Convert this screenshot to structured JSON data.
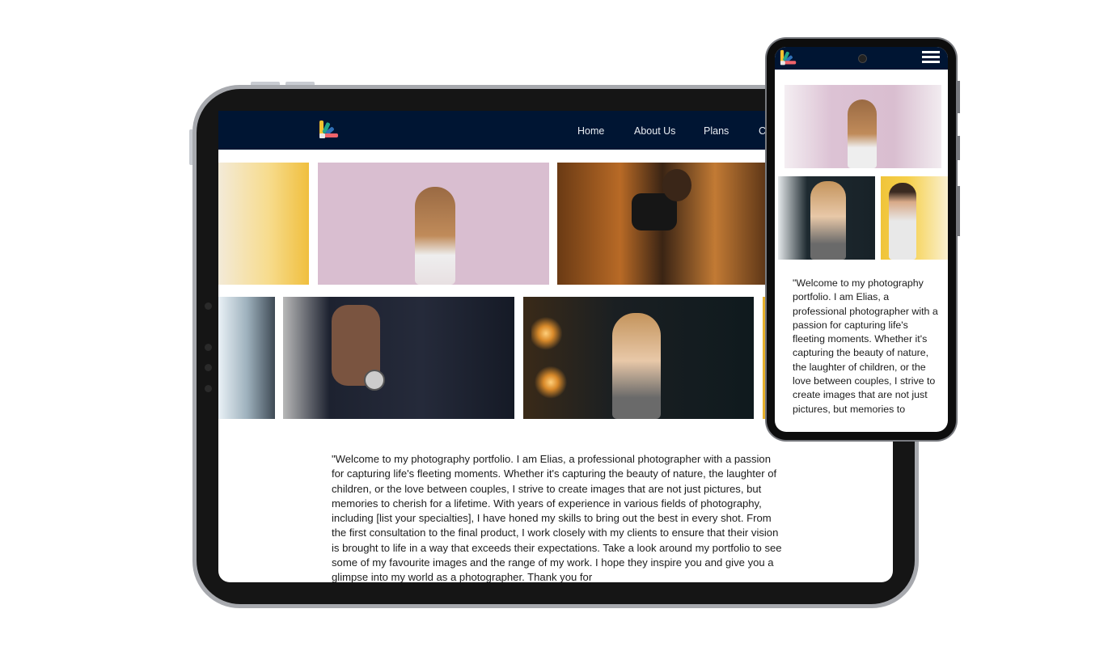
{
  "brand": {
    "logo": "palette-fan-logo",
    "colors": {
      "nav_bg": "#001533",
      "logo": [
        "#f5c12e",
        "#22a58a",
        "#2f6fb6",
        "#f0636a",
        "#e8e8e8"
      ]
    }
  },
  "tablet": {
    "nav": {
      "links": [
        "Home",
        "About Us",
        "Plans",
        "C"
      ]
    },
    "gallery": {
      "row1": [
        "yellow-flowers-photo",
        "woman-pink-background-photo",
        "camera-toss-forest-photo"
      ],
      "row2": [
        "blurred-building-photo",
        "man-suit-watch-photo",
        "woman-lights-photo",
        "yellow-partial-photo"
      ]
    },
    "intro_text": "\"Welcome to my photography portfolio. I am Elias, a professional photographer with a passion for capturing life's fleeting moments. Whether it's capturing the beauty of nature, the laughter of children, or the love between couples, I strive to create images that are not just pictures, but memories to cherish for a lifetime. With years of experience in various fields of photography, including [list your specialties], I have honed my skills to bring out the best in every shot. From the first consultation to the final product, I work closely with my clients to ensure that their vision is brought to life in a way that exceeds their expectations. Take a look around my portfolio to see some of my favourite images and the range of my work. I hope they inspire you and give you a glimpse into my world as a photographer. Thank you for"
  },
  "phone": {
    "nav": {
      "menu_icon": "hamburger-menu-icon"
    },
    "gallery": [
      "woman-pink-background-photo",
      "woman-lights-photo",
      "man-yellow-background-photo"
    ],
    "intro_text": "\"Welcome to my photography portfolio. I am Elias, a professional photographer with a passion for capturing life's fleeting moments. Whether it's capturing the beauty of nature, the laughter of children, or the love between couples, I strive to create images that are not just pictures, but memories to"
  }
}
